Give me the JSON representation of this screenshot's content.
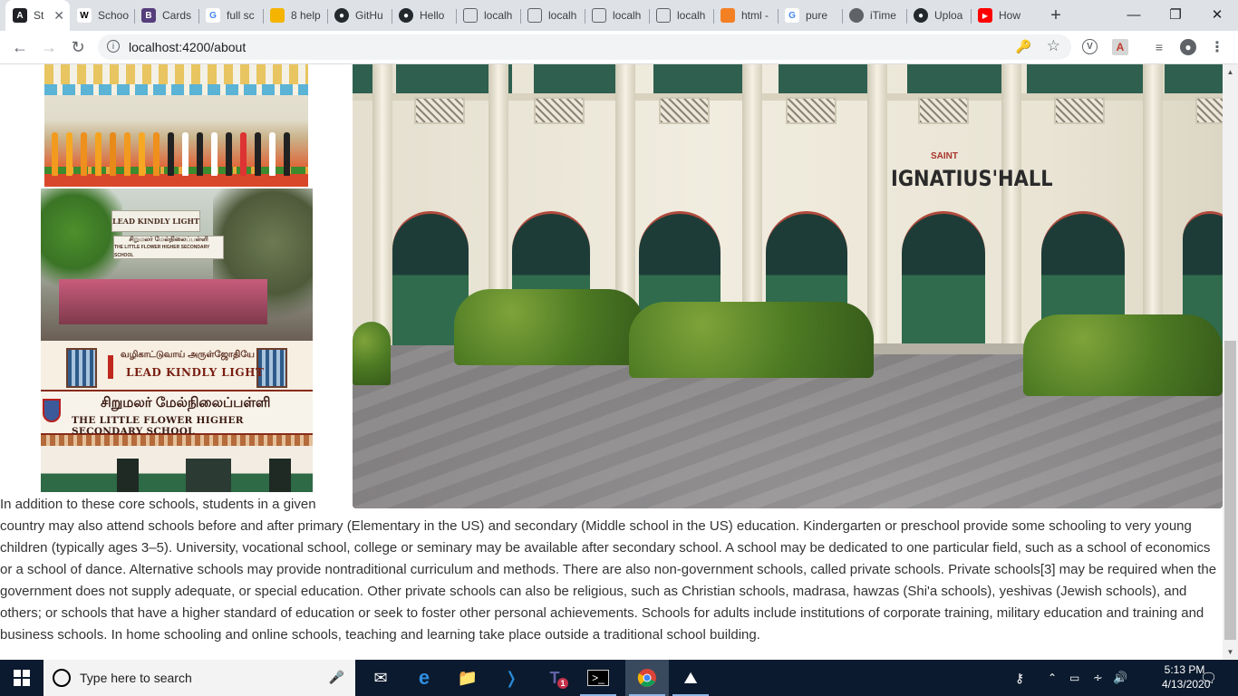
{
  "browser": {
    "tabs": [
      {
        "title": "St",
        "favicon": "angular-icon",
        "color": "#202124",
        "active": true
      },
      {
        "title": "Schoo",
        "favicon": "wikipedia-icon",
        "color": "#ffffff"
      },
      {
        "title": "Cards",
        "favicon": "bootstrap-icon",
        "color": "#563d7c"
      },
      {
        "title": "full sc",
        "favicon": "google-icon",
        "color": "#4285f4"
      },
      {
        "title": "8 help",
        "favicon": "help-icon",
        "color": "#f4b400"
      },
      {
        "title": "GitHu",
        "favicon": "github-icon",
        "color": "#24292e"
      },
      {
        "title": "Hello",
        "favicon": "github-icon",
        "color": "#24292e"
      },
      {
        "title": "localh",
        "favicon": "localhost-icon",
        "color": "#5f6368"
      },
      {
        "title": "localh",
        "favicon": "localhost-icon",
        "color": "#5f6368"
      },
      {
        "title": "localh",
        "favicon": "localhost-icon",
        "color": "#5f6368"
      },
      {
        "title": "localh",
        "favicon": "localhost-icon",
        "color": "#5f6368"
      },
      {
        "title": "html -",
        "favicon": "stackoverflow-icon",
        "color": "#f48024"
      },
      {
        "title": "pure",
        "favicon": "google-icon",
        "color": "#4285f4"
      },
      {
        "title": "iTime",
        "favicon": "globe-icon",
        "color": "#5f6368"
      },
      {
        "title": "Uploa",
        "favicon": "github-icon",
        "color": "#24292e"
      },
      {
        "title": "How",
        "favicon": "youtube-icon",
        "color": "#ff0000"
      }
    ],
    "url": "localhost:4200/about"
  },
  "page": {
    "photos": {
      "hall_sign_saint": "SAINT",
      "hall_sign_name": "IGNATIUS'HALL",
      "sign_lead_kindly_light": "LEAD KINDLY LIGHT",
      "sign_school_name": "THE LITTLE FLOWER HIGHER SECONDARY SCHOOL",
      "sign_tamil_motto": "வழிகாட்டுவாய் அருள்ஜோதியே",
      "sign_tamil_school": "சிறுமலர் மேல்நிலைப்பள்ளி",
      "sign_small_top": "LEAD KINDLY LIGHT",
      "sign_small_bottom_tamil": "சிறுமலர் மேல்நிலைப்பள்ளி",
      "sign_small_bottom": "THE LITTLE FLOWER HIGHER SECONDARY SCHOOL"
    },
    "paragraph": "In addition to these core schools, students in a given country may also attend schools before and after primary (Elementary in the US) and secondary (Middle school in the US) education. Kindergarten or preschool provide some schooling to very young children (typically ages 3–5). University, vocational school, college or seminary may be available after secondary school. A school may be dedicated to one particular field, such as a school of economics or a school of dance. Alternative schools may provide nontraditional curriculum and methods. There are also non-government schools, called private schools. Private schools[3] may be required when the government does not supply adequate, or special education. Other private schools can also be religious, such as Christian schools, madrasa, hawzas (Shi'a schools), yeshivas (Jewish schools), and others; or schools that have a higher standard of education or seek to foster other personal achievements. Schools for adults include institutions of corporate training, military education and training and business schools. In home schooling and online schools, teaching and learning take place outside a traditional school building."
  },
  "taskbar": {
    "search_placeholder": "Type here to search",
    "teams_badge": "1",
    "time": "5:13 PM",
    "date": "4/13/2020"
  }
}
